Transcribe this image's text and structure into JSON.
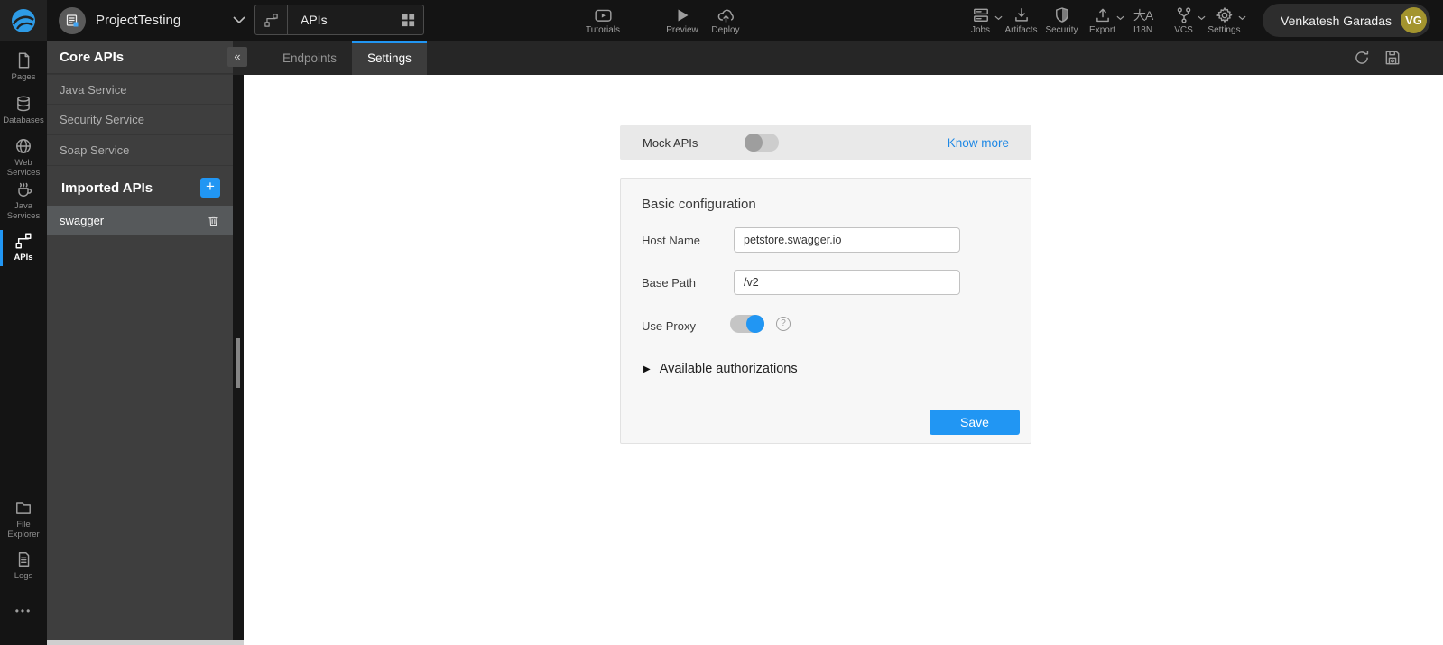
{
  "topbar": {
    "project_name": "ProjectTesting",
    "workspace_selector": {
      "label": "APIs"
    },
    "center_actions": [
      {
        "label": "Tutorials",
        "icon": "youtube-icon"
      },
      {
        "label": "Preview",
        "icon": "play-icon"
      },
      {
        "label": "Deploy",
        "icon": "cloud-upload-icon"
      }
    ],
    "right_actions": [
      {
        "label": "Jobs",
        "icon": "server-icon",
        "has_dropdown": true
      },
      {
        "label": "Artifacts",
        "icon": "download-icon",
        "has_dropdown": false
      },
      {
        "label": "Security",
        "icon": "shield-icon",
        "has_dropdown": false
      },
      {
        "label": "Export",
        "icon": "upload-icon",
        "has_dropdown": true
      },
      {
        "label": "I18N",
        "icon": "translate-icon",
        "has_dropdown": false
      },
      {
        "label": "VCS",
        "icon": "branch-icon",
        "has_dropdown": true
      },
      {
        "label": "Settings",
        "icon": "gear-icon",
        "has_dropdown": true
      }
    ],
    "user": {
      "name": "Venkatesh Garadas",
      "initials": "VG",
      "avatar_color": "#a3942e"
    }
  },
  "sidebar": {
    "items": [
      {
        "label": "Pages",
        "icon": "page-icon",
        "active": false
      },
      {
        "label": "Databases",
        "icon": "database-icon",
        "active": false
      },
      {
        "label": "Web Services",
        "icon": "globe-icon",
        "active": false
      },
      {
        "label": "Java Services",
        "icon": "coffee-icon",
        "active": false
      },
      {
        "label": "APIs",
        "icon": "api-nodes-icon",
        "active": true
      },
      {
        "label": "File Explorer",
        "icon": "folder-icon",
        "active": false
      },
      {
        "label": "Logs",
        "icon": "log-file-icon",
        "active": false
      }
    ],
    "more_glyph": "•••"
  },
  "panel": {
    "title": "Core APIs",
    "collapse_glyph": "«",
    "core_items": [
      "Java Service",
      "Security Service",
      "Soap Service"
    ],
    "imported_title": "Imported APIs",
    "add_glyph": "+",
    "imported_items": [
      {
        "label": "swagger",
        "selected": true
      }
    ]
  },
  "tabbar": {
    "tabs": [
      {
        "label": "Endpoints",
        "active": false
      },
      {
        "label": "Settings",
        "active": true
      }
    ],
    "icons": [
      "refresh-icon",
      "save-icon"
    ]
  },
  "settings_page": {
    "mock_apis": {
      "label": "Mock APIs",
      "enabled": false,
      "link_label": "Know more"
    },
    "basic_config": {
      "title": "Basic configuration",
      "host_name": {
        "label": "Host Name",
        "value": "petstore.swagger.io"
      },
      "base_path": {
        "label": "Base Path",
        "value": "/v2"
      },
      "use_proxy": {
        "label": "Use Proxy",
        "enabled": true,
        "help_glyph": "?"
      },
      "authorizations": {
        "label": "Available authorizations",
        "expander_glyph": "▶"
      },
      "save_label": "Save"
    }
  },
  "colors": {
    "accent": "#2196f3",
    "link": "#1e88e5",
    "avatar": "#a3942e",
    "active_tab_border": "#2196f3"
  }
}
